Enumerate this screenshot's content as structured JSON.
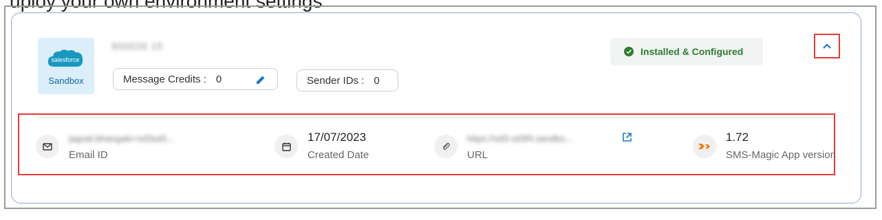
{
  "caption": "uploy your own environment settings",
  "org": {
    "logo_text": "salesforce",
    "env_label": "Sandbox",
    "name": "900026 15",
    "credits_label": "Message Credits :",
    "credits_value": "0",
    "sender_ids_label": "Sender IDs :",
    "sender_ids_value": "0",
    "status": "Installed & Configured"
  },
  "details": [
    {
      "value": "jagrati.bhangale+sd3sd3...",
      "label": "Email ID"
    },
    {
      "value": "17/07/2023",
      "label": "Created Date"
    },
    {
      "value": "https://sd3-sd3f4.sandbo...",
      "label": "URL"
    },
    {
      "value": "1.72",
      "label": "SMS-Magic App version"
    }
  ],
  "colors": {
    "accent_blue": "#1976d2",
    "success_green": "#2e7d32",
    "highlight_red": "#e53935",
    "smsmagic_orange": "#f57c00"
  },
  "icons": [
    "salesforce-logo",
    "edit-icon",
    "check-circle-icon",
    "chevron-up-icon",
    "mail-icon",
    "calendar-icon",
    "paperclip-icon",
    "external-link-icon",
    "sms-magic-icon"
  ]
}
